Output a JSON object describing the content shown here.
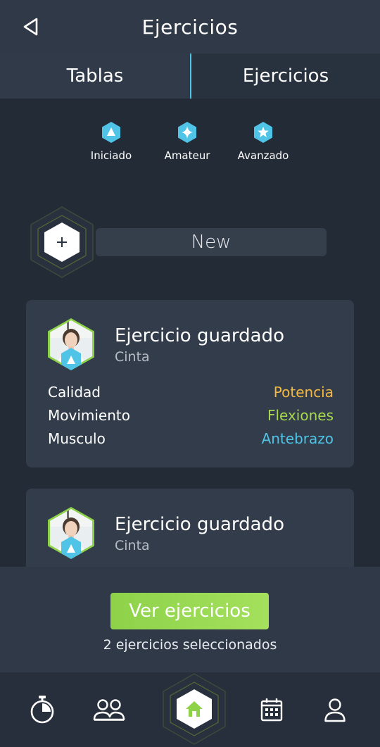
{
  "header": {
    "title": "Ejercicios",
    "back_icon": "back-triangle-icon"
  },
  "tabs": [
    {
      "label": "Tablas",
      "active": false
    },
    {
      "label": "Ejercicios",
      "active": true
    }
  ],
  "levels": [
    {
      "label": "Iniciado",
      "icon": "triangle-icon"
    },
    {
      "label": "Amateur",
      "icon": "sparkle-icon"
    },
    {
      "label": "Avanzado",
      "icon": "star-icon"
    }
  ],
  "new_item": {
    "label": "New",
    "icon": "plus-icon"
  },
  "cards": [
    {
      "title": "Ejercicio guardado",
      "subtitle": "Cinta",
      "attributes": [
        {
          "label": "Calidad",
          "value": "Potencia",
          "color": "#f2b944"
        },
        {
          "label": "Movimiento",
          "value": "Flexiones",
          "color": "#a8d84f"
        },
        {
          "label": "Musculo",
          "value": "Antebrazo",
          "color": "#4fc4e6"
        }
      ]
    },
    {
      "title": "Ejercicio guardado",
      "subtitle": "Cinta"
    }
  ],
  "footer": {
    "button_label": "Ver ejercicios",
    "selected_text": "2 ejercicios seleccionados"
  },
  "nav": [
    "stopwatch-icon",
    "group-icon",
    "home-icon",
    "calendar-icon",
    "profile-icon"
  ],
  "colors": {
    "accent_blue": "#4fc4e6",
    "accent_green": "#8ed24a",
    "background": "#232b37"
  }
}
